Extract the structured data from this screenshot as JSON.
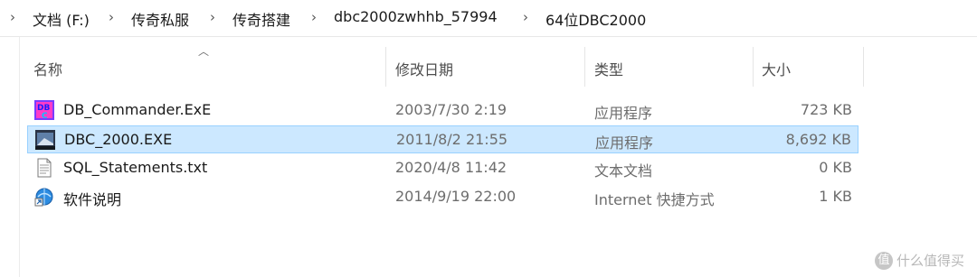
{
  "breadcrumb": {
    "items": [
      "文档 (F:)",
      "传奇私服",
      "传奇搭建",
      "dbc2000zwhhb_57994",
      "64位DBC2000"
    ]
  },
  "columns": {
    "name": "名称",
    "date": "修改日期",
    "type": "类型",
    "size": "大小"
  },
  "files": [
    {
      "name": "DB_Commander.ExE",
      "date": "2003/7/30 2:19",
      "type": "应用程序",
      "size": "723 KB",
      "icon": "db-commander-app-icon",
      "selected": false
    },
    {
      "name": "DBC_2000.EXE",
      "date": "2011/8/2 21:55",
      "type": "应用程序",
      "size": "8,692 KB",
      "icon": "dbc2000-app-icon",
      "selected": true
    },
    {
      "name": "SQL_Statements.txt",
      "date": "2020/4/8 11:42",
      "type": "文本文档",
      "size": "0 KB",
      "icon": "text-document-icon",
      "selected": false
    },
    {
      "name": "软件说明",
      "date": "2014/9/19 22:00",
      "type": "Internet 快捷方式",
      "size": "1 KB",
      "icon": "internet-shortcut-icon",
      "selected": false
    }
  ],
  "watermark": {
    "badge": "值",
    "text": "什么值得买"
  },
  "colors": {
    "selection_bg": "#cce8ff",
    "selection_border": "#99d1ff"
  }
}
